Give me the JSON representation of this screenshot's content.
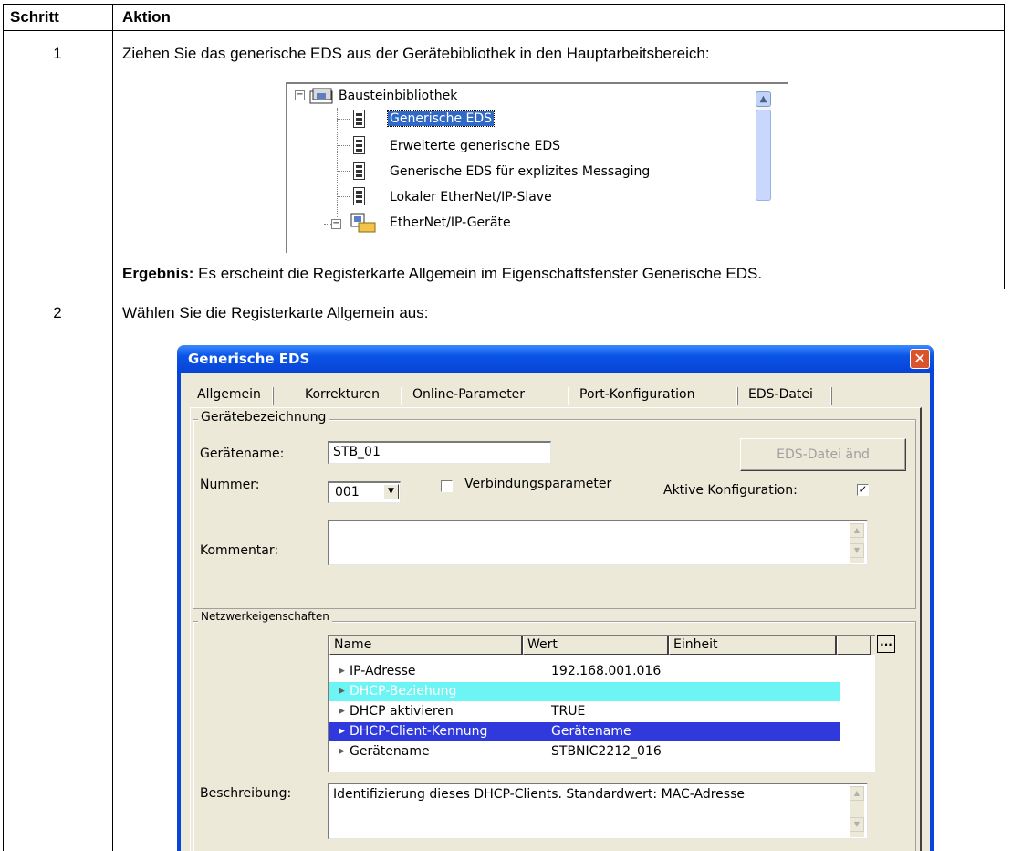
{
  "table": {
    "header": {
      "step": "Schritt",
      "action": "Aktion"
    },
    "rows": [
      {
        "step": "1",
        "instruction": "Ziehen Sie das generische EDS aus der Gerätebibliothek in den Hauptarbeitsbereich:",
        "result_label": "Ergebnis:",
        "result_text": " Es erscheint die Registerkarte Allgemein im Eigenschaftsfenster Generische EDS."
      },
      {
        "step": "2",
        "instruction": "Wählen Sie die Registerkarte Allgemein aus:"
      }
    ]
  },
  "tree": {
    "root": "Bausteinbibliothek",
    "items": [
      {
        "label": "Generische EDS",
        "selected": true
      },
      {
        "label": "Erweiterte generische EDS"
      },
      {
        "label": "Generische EDS für explizites Messaging"
      },
      {
        "label": "Lokaler EtherNet/IP-Slave"
      }
    ],
    "folder": "EtherNet/IP-Geräte"
  },
  "dialog": {
    "title": "Generische EDS",
    "tabs": [
      "Allgemein",
      "Korrekturen",
      "Online-Parameter",
      "Port-Konfiguration",
      "EDS-Datei"
    ],
    "active_tab": "Allgemein",
    "device_group": {
      "title": "Gerätebezeichnung",
      "device_name_label": "Gerätename:",
      "device_name_value": "STB_01",
      "eds_button": "EDS-Datei änd",
      "number_label": "Nummer:",
      "number_value": "001",
      "connection_params_label": "Verbindungsparameter",
      "connection_params_checked": false,
      "active_config_label": "Aktive Konfiguration:",
      "active_config_checked": true,
      "comment_label": "Kommentar:",
      "comment_value": ""
    },
    "network_group": {
      "title": "Netzwerkeigenschaften",
      "columns": [
        "Name",
        "Wert",
        "Einheit"
      ],
      "more_button": "...",
      "rows": [
        {
          "name": "IP-Adresse",
          "value": "192.168.001.016",
          "style": "normal"
        },
        {
          "name": "DHCP-Beziehung",
          "value": "",
          "style": "cyan"
        },
        {
          "name": "DHCP aktivieren",
          "value": "TRUE",
          "style": "normal"
        },
        {
          "name": "DHCP-Client-Kennung",
          "value": "Gerätename",
          "style": "selected"
        },
        {
          "name": "Gerätename",
          "value": "STBNIC2212_016",
          "style": "normal"
        }
      ],
      "description_label": "Beschreibung:",
      "description_value": "Identifizierung dieses DHCP-Clients. Standardwert: MAC-Adresse"
    },
    "colors": {
      "title_bar": "#0a54e6",
      "selection": "#2f39dc",
      "highlight_cyan": "#6df4f4",
      "dialog_bg": "#ece9d8"
    }
  }
}
